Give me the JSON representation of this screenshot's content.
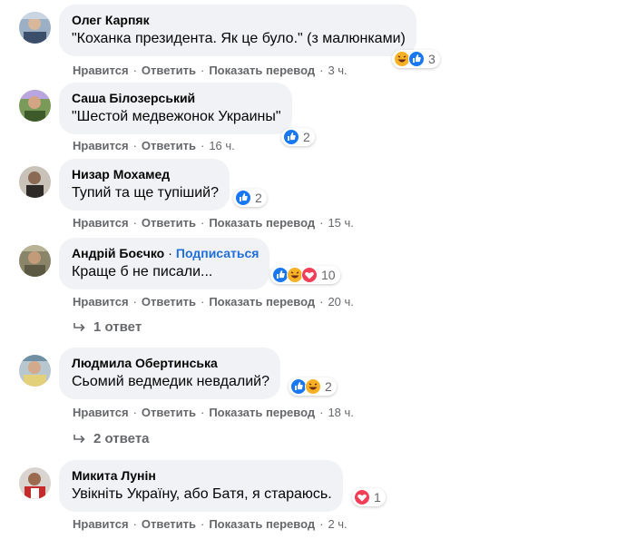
{
  "actions": {
    "like": "Нравится",
    "reply": "Ответить",
    "translate": "Показать перевод"
  },
  "comments": [
    {
      "author": "Олег Карпяк",
      "text": "\"Коханка президента. Як це було.\" (з малюнками)",
      "time": "3 ч.",
      "reactions": [
        "haha",
        "like"
      ],
      "reaction_count": "3"
    },
    {
      "author": "Саша Білозерський",
      "text": "\"Шестой медвежонок Украины\"",
      "time": "16 ч.",
      "reactions": [
        "like"
      ],
      "reaction_count": "2"
    },
    {
      "author": "Низар Мохамед",
      "text": "Тупий та ще тупіший?",
      "time": "15 ч.",
      "reactions": [
        "like"
      ],
      "reaction_count": "2"
    },
    {
      "author": "Андрій Боєчко",
      "follow_label": "Подписаться",
      "text": "Краще б не писали...",
      "time": "20 ч.",
      "reactions": [
        "like",
        "haha",
        "love"
      ],
      "reaction_count": "10",
      "replies": "1 ответ"
    },
    {
      "author": "Людмила Обертинська",
      "text": "Сьомий ведмедик невдалий?",
      "time": "18 ч.",
      "reactions": [
        "like",
        "haha"
      ],
      "reaction_count": "2",
      "replies": "2 ответа"
    },
    {
      "author": "Микита Лунін",
      "text": "Увікніть Україну, або Батя, я стараюсь.",
      "time": "2 ч.",
      "reactions": [
        "love"
      ],
      "reaction_count": "1"
    }
  ],
  "colors": {
    "like": "#1877f2",
    "love": "#f33e58",
    "haha": "#f7b125",
    "meta_text": "#65676b",
    "bubble": "#f0f2f5"
  }
}
